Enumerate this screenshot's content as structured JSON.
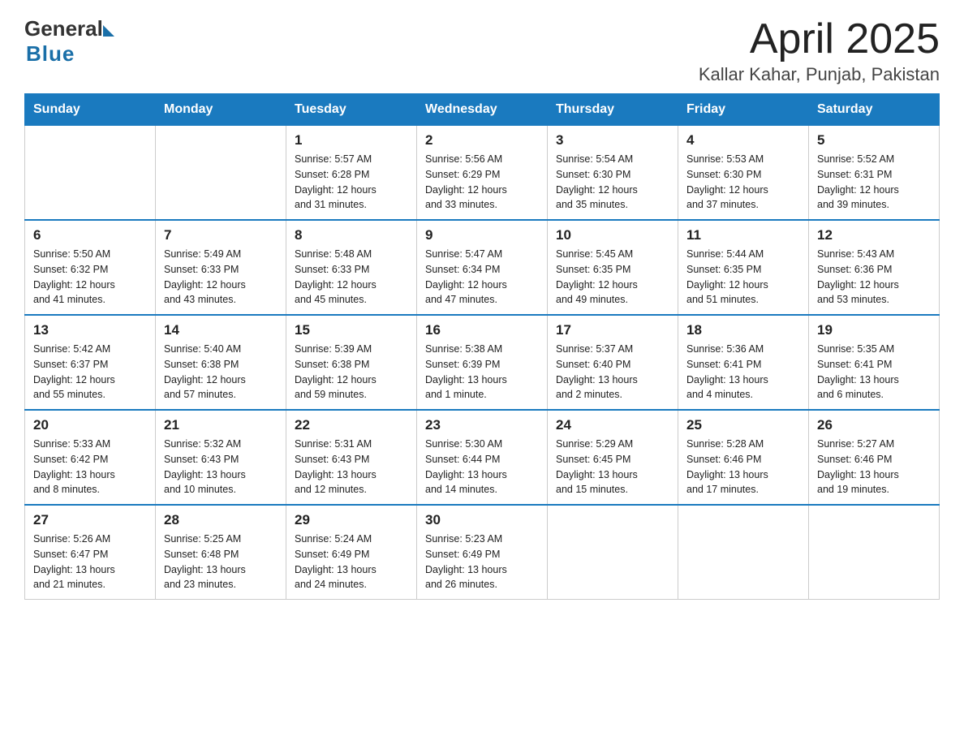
{
  "logo": {
    "text_general": "General",
    "text_blue": "Blue"
  },
  "title": {
    "month_year": "April 2025",
    "location": "Kallar Kahar, Punjab, Pakistan"
  },
  "weekdays": [
    "Sunday",
    "Monday",
    "Tuesday",
    "Wednesday",
    "Thursday",
    "Friday",
    "Saturday"
  ],
  "weeks": [
    [
      {
        "day": "",
        "info": ""
      },
      {
        "day": "",
        "info": ""
      },
      {
        "day": "1",
        "info": "Sunrise: 5:57 AM\nSunset: 6:28 PM\nDaylight: 12 hours\nand 31 minutes."
      },
      {
        "day": "2",
        "info": "Sunrise: 5:56 AM\nSunset: 6:29 PM\nDaylight: 12 hours\nand 33 minutes."
      },
      {
        "day": "3",
        "info": "Sunrise: 5:54 AM\nSunset: 6:30 PM\nDaylight: 12 hours\nand 35 minutes."
      },
      {
        "day": "4",
        "info": "Sunrise: 5:53 AM\nSunset: 6:30 PM\nDaylight: 12 hours\nand 37 minutes."
      },
      {
        "day": "5",
        "info": "Sunrise: 5:52 AM\nSunset: 6:31 PM\nDaylight: 12 hours\nand 39 minutes."
      }
    ],
    [
      {
        "day": "6",
        "info": "Sunrise: 5:50 AM\nSunset: 6:32 PM\nDaylight: 12 hours\nand 41 minutes."
      },
      {
        "day": "7",
        "info": "Sunrise: 5:49 AM\nSunset: 6:33 PM\nDaylight: 12 hours\nand 43 minutes."
      },
      {
        "day": "8",
        "info": "Sunrise: 5:48 AM\nSunset: 6:33 PM\nDaylight: 12 hours\nand 45 minutes."
      },
      {
        "day": "9",
        "info": "Sunrise: 5:47 AM\nSunset: 6:34 PM\nDaylight: 12 hours\nand 47 minutes."
      },
      {
        "day": "10",
        "info": "Sunrise: 5:45 AM\nSunset: 6:35 PM\nDaylight: 12 hours\nand 49 minutes."
      },
      {
        "day": "11",
        "info": "Sunrise: 5:44 AM\nSunset: 6:35 PM\nDaylight: 12 hours\nand 51 minutes."
      },
      {
        "day": "12",
        "info": "Sunrise: 5:43 AM\nSunset: 6:36 PM\nDaylight: 12 hours\nand 53 minutes."
      }
    ],
    [
      {
        "day": "13",
        "info": "Sunrise: 5:42 AM\nSunset: 6:37 PM\nDaylight: 12 hours\nand 55 minutes."
      },
      {
        "day": "14",
        "info": "Sunrise: 5:40 AM\nSunset: 6:38 PM\nDaylight: 12 hours\nand 57 minutes."
      },
      {
        "day": "15",
        "info": "Sunrise: 5:39 AM\nSunset: 6:38 PM\nDaylight: 12 hours\nand 59 minutes."
      },
      {
        "day": "16",
        "info": "Sunrise: 5:38 AM\nSunset: 6:39 PM\nDaylight: 13 hours\nand 1 minute."
      },
      {
        "day": "17",
        "info": "Sunrise: 5:37 AM\nSunset: 6:40 PM\nDaylight: 13 hours\nand 2 minutes."
      },
      {
        "day": "18",
        "info": "Sunrise: 5:36 AM\nSunset: 6:41 PM\nDaylight: 13 hours\nand 4 minutes."
      },
      {
        "day": "19",
        "info": "Sunrise: 5:35 AM\nSunset: 6:41 PM\nDaylight: 13 hours\nand 6 minutes."
      }
    ],
    [
      {
        "day": "20",
        "info": "Sunrise: 5:33 AM\nSunset: 6:42 PM\nDaylight: 13 hours\nand 8 minutes."
      },
      {
        "day": "21",
        "info": "Sunrise: 5:32 AM\nSunset: 6:43 PM\nDaylight: 13 hours\nand 10 minutes."
      },
      {
        "day": "22",
        "info": "Sunrise: 5:31 AM\nSunset: 6:43 PM\nDaylight: 13 hours\nand 12 minutes."
      },
      {
        "day": "23",
        "info": "Sunrise: 5:30 AM\nSunset: 6:44 PM\nDaylight: 13 hours\nand 14 minutes."
      },
      {
        "day": "24",
        "info": "Sunrise: 5:29 AM\nSunset: 6:45 PM\nDaylight: 13 hours\nand 15 minutes."
      },
      {
        "day": "25",
        "info": "Sunrise: 5:28 AM\nSunset: 6:46 PM\nDaylight: 13 hours\nand 17 minutes."
      },
      {
        "day": "26",
        "info": "Sunrise: 5:27 AM\nSunset: 6:46 PM\nDaylight: 13 hours\nand 19 minutes."
      }
    ],
    [
      {
        "day": "27",
        "info": "Sunrise: 5:26 AM\nSunset: 6:47 PM\nDaylight: 13 hours\nand 21 minutes."
      },
      {
        "day": "28",
        "info": "Sunrise: 5:25 AM\nSunset: 6:48 PM\nDaylight: 13 hours\nand 23 minutes."
      },
      {
        "day": "29",
        "info": "Sunrise: 5:24 AM\nSunset: 6:49 PM\nDaylight: 13 hours\nand 24 minutes."
      },
      {
        "day": "30",
        "info": "Sunrise: 5:23 AM\nSunset: 6:49 PM\nDaylight: 13 hours\nand 26 minutes."
      },
      {
        "day": "",
        "info": ""
      },
      {
        "day": "",
        "info": ""
      },
      {
        "day": "",
        "info": ""
      }
    ]
  ]
}
